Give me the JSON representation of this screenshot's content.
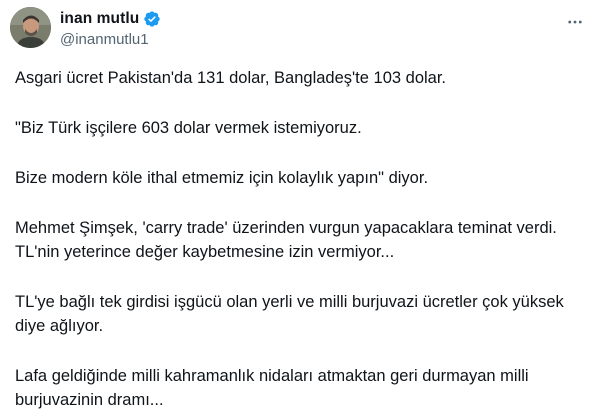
{
  "author": {
    "display_name": "inan mutlu",
    "handle": "@inanmutlu1",
    "verified_color": "#1d9bf0"
  },
  "icons": {
    "verified": "verified-badge-icon",
    "more": "more-options-icon"
  },
  "paragraphs": [
    "Asgari ücret Pakistan'da 131 dolar, Bangladeş'te 103 dolar.",
    "\"Biz Türk işçilere 603 dolar vermek istemiyoruz.",
    "Bize modern köle ithal etmemiz için kolaylık yapın\" diyor.",
    "Mehmet Şimşek, 'carry trade' üzerinden vurgun yapacaklara teminat verdi. TL'nin yeterince değer kaybetmesine izin vermiyor...",
    "TL'ye bağlı tek girdisi işgücü olan yerli ve milli burjuvazi ücretler çok yüksek diye ağlıyor.",
    "Lafa geldiğinde milli kahramanlık nidaları atmaktan geri durmayan milli burjuvazinin dramı..."
  ]
}
